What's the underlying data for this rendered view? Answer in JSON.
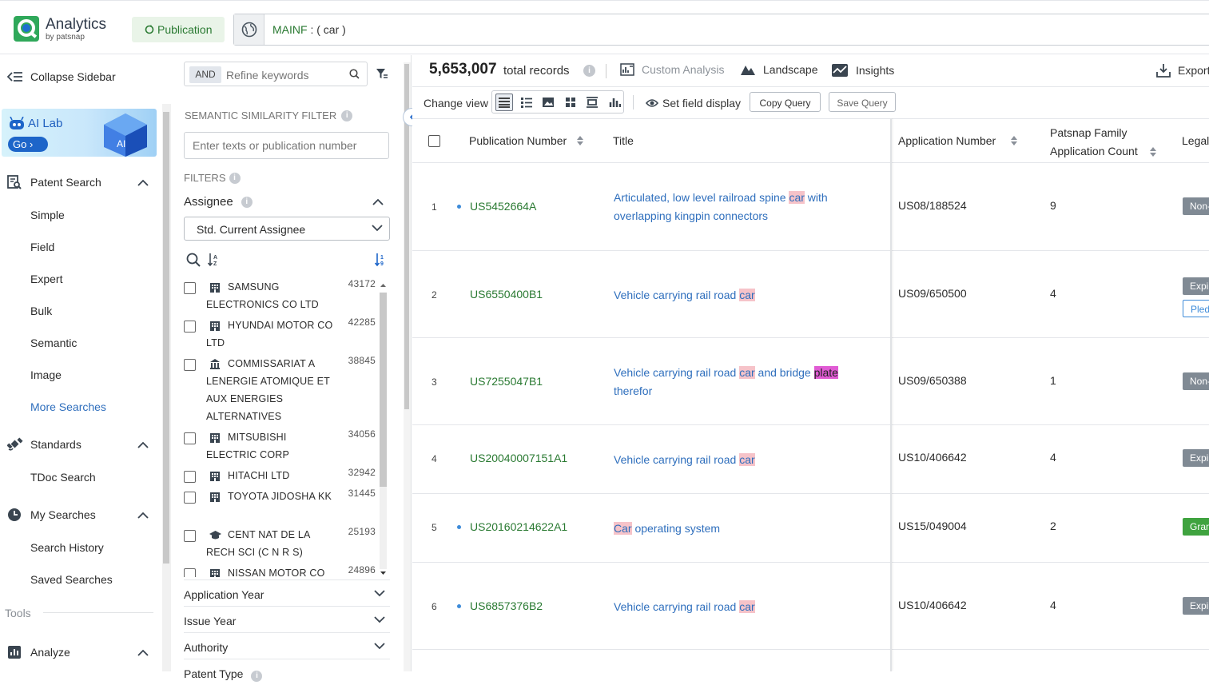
{
  "brand": {
    "name": "Analytics",
    "sub": "by patsnap"
  },
  "header": {
    "publication_label": "Publication",
    "query_field": "MAINF",
    "query_rest": " : ( car )"
  },
  "sidebar": {
    "collapse_label": "Collapse Sidebar",
    "ailab": {
      "title": "AI Lab",
      "go": "Go ›",
      "cube_text": "AI"
    },
    "patent_search": {
      "label": "Patent Search",
      "items": [
        "Simple",
        "Field",
        "Expert",
        "Bulk",
        "Semantic",
        "Image"
      ],
      "more": "More Searches"
    },
    "standards": {
      "label": "Standards",
      "items": [
        "TDoc Search"
      ]
    },
    "my_searches": {
      "label": "My Searches",
      "items": [
        "Search History",
        "Saved Searches"
      ]
    },
    "tools_label": "Tools",
    "analyze_label": "Analyze"
  },
  "filters": {
    "and_label": "AND",
    "keyword_placeholder": "Refine keywords",
    "semantic_title": "SEMANTIC SIMILARITY FILTER",
    "semantic_placeholder": "Enter texts or publication number",
    "filters_title": "FILTERS",
    "assignee_title": "Assignee",
    "assignee_select": "Std. Current Assignee",
    "assignees": [
      {
        "name": "SAMSUNG ELECTRONICS CO LTD",
        "count": "43172",
        "icon": "building-icon"
      },
      {
        "name": "HYUNDAI MOTOR CO LTD",
        "count": "42285",
        "icon": "building-icon"
      },
      {
        "name": "COMMISSARIAT A LENERGIE ATOMIQUE ET AUX ENERGIES ALTERNATIVES",
        "count": "38845",
        "icon": "institution-icon"
      },
      {
        "name": "MITSUBISHI ELECTRIC CORP",
        "count": "34056",
        "icon": "building-icon"
      },
      {
        "name": "HITACHI LTD",
        "count": "32942",
        "icon": "building-icon"
      },
      {
        "name": "TOYOTA JIDOSHA KK",
        "count": "31445",
        "icon": "building-icon"
      },
      {
        "name": "CENT NAT DE LA RECH SCI (C N R S)",
        "count": "25193",
        "icon": "graduation-cap-icon"
      },
      {
        "name": "NISSAN MOTOR CO",
        "count": "24896",
        "icon": "building-icon"
      }
    ],
    "facets": [
      "Application Year",
      "Issue Year",
      "Authority",
      "Patent Type"
    ]
  },
  "toolbar": {
    "total": "5,653,007",
    "total_label": "total records",
    "custom_analysis": "Custom Analysis",
    "landscape": "Landscape",
    "insights": "Insights",
    "export": "Export",
    "change_view": "Change view",
    "set_field_display": "Set field display",
    "copy_query": "Copy Query",
    "save_query": "Save Query"
  },
  "table": {
    "headers": {
      "pub": "Publication Number",
      "title": "Title",
      "app": "Application Number",
      "family_l1": "Patsnap Family",
      "family_l2": "Application Count",
      "legal": "Legal Status"
    },
    "rows": [
      {
        "idx": "1",
        "dot": true,
        "pn": "US5452664A",
        "title": [
          "Articulated, low level railroad spine ",
          {
            "h": "car"
          },
          " with overlapping kingpin connectors"
        ],
        "an": "US08/188524",
        "fc": "9",
        "tags": [
          {
            "t": "Non-",
            "c": "grey"
          }
        ]
      },
      {
        "idx": "2",
        "dot": false,
        "pn": "US6550400B1",
        "title": [
          "Vehicle carrying rail road ",
          {
            "h": "car"
          }
        ],
        "an": "US09/650500",
        "fc": "4",
        "tags": [
          {
            "t": "Expired",
            "c": "grey"
          },
          {
            "t": "Pledged",
            "c": "out"
          }
        ]
      },
      {
        "idx": "3",
        "dot": false,
        "pn": "US7255047B1",
        "title": [
          "Vehicle carrying rail road ",
          {
            "h": "car"
          },
          " and bridge ",
          {
            "h2": "plate"
          },
          " therefor"
        ],
        "an": "US09/650388",
        "fc": "1",
        "tags": [
          {
            "t": "Non-",
            "c": "grey"
          }
        ]
      },
      {
        "idx": "4",
        "dot": false,
        "pn": "US20040007151A1",
        "title": [
          "Vehicle carrying rail road ",
          {
            "h": "car"
          }
        ],
        "an": "US10/406642",
        "fc": "4",
        "tags": [
          {
            "t": "Expired",
            "c": "grey"
          }
        ]
      },
      {
        "idx": "5",
        "dot": true,
        "pn": "US20160214622A1",
        "title": [
          {
            "h": "Car"
          },
          " operating system"
        ],
        "an": "US15/049004",
        "fc": "2",
        "tags": [
          {
            "t": "Granted",
            "c": "green"
          }
        ]
      },
      {
        "idx": "6",
        "dot": true,
        "pn": "US6857376B2",
        "title": [
          "Vehicle carrying rail road ",
          {
            "h": "car"
          }
        ],
        "an": "US10/406642",
        "fc": "4",
        "tags": [
          {
            "t": "Expired",
            "c": "grey"
          }
        ]
      }
    ]
  },
  "colors": {
    "accent_green": "#2a7a32",
    "link_blue": "#2f6fbd",
    "highlight": "#f6c3c9"
  }
}
